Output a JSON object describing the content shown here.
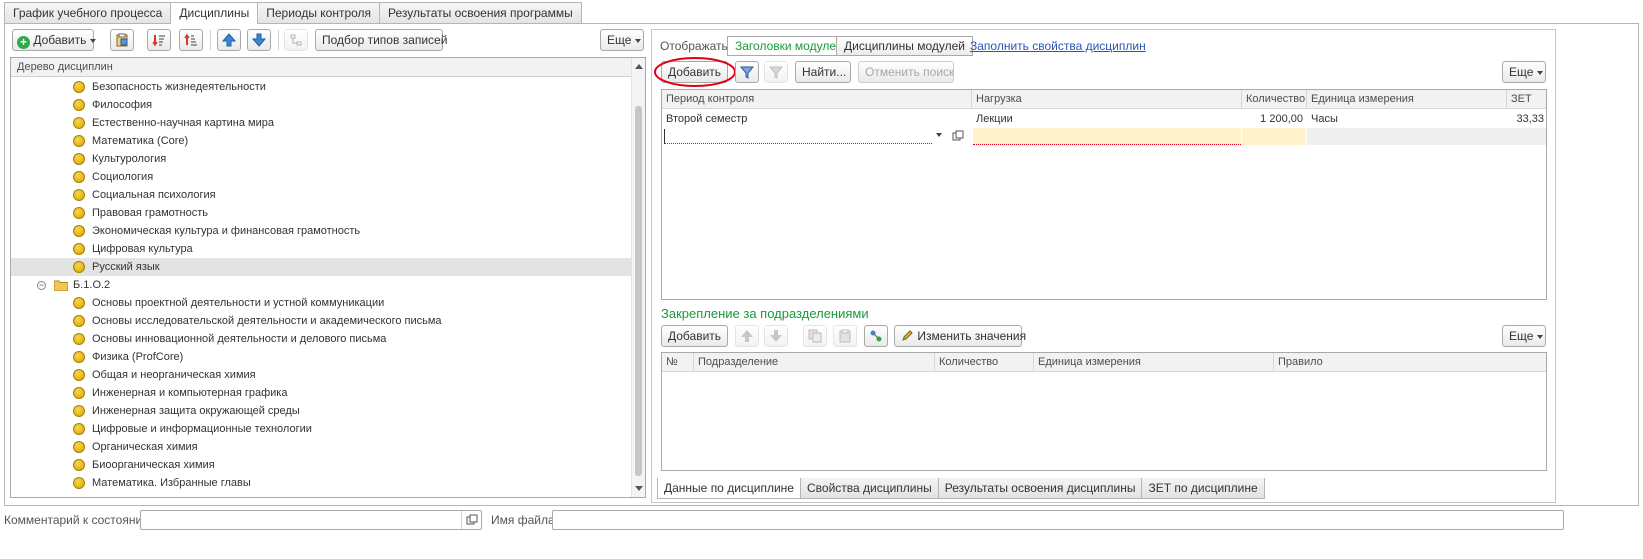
{
  "tabs": [
    {
      "label": "График учебного процесса",
      "active": false
    },
    {
      "label": "Дисциплины",
      "active": true
    },
    {
      "label": "Периоды контроля",
      "active": false
    },
    {
      "label": "Результаты освоения программы",
      "active": false
    }
  ],
  "left_toolbar": {
    "add_label": "Добавить",
    "select_types_label": "Подбор типов записей",
    "more_label": "Еще"
  },
  "tree": {
    "header": "Дерево дисциплин",
    "items": [
      {
        "label": "Безопасность жизнедеятельности"
      },
      {
        "label": "Философия"
      },
      {
        "label": "Естественно-научная картина мира"
      },
      {
        "label": "Математика (Core)"
      },
      {
        "label": "Культурология"
      },
      {
        "label": "Социология"
      },
      {
        "label": "Социальная психология"
      },
      {
        "label": "Правовая грамотность"
      },
      {
        "label": "Экономическая культура и финансовая грамотность"
      },
      {
        "label": "Цифровая культура"
      },
      {
        "label": "Русский язык"
      },
      {
        "label": "Б.1.О.2"
      },
      {
        "label": "Основы проектной деятельности и устной коммуникации"
      },
      {
        "label": "Основы исследовательской деятельности и академического письма"
      },
      {
        "label": "Основы инновационной деятельности и делового письма"
      },
      {
        "label": "Физика (ProfCore)"
      },
      {
        "label": "Общая и неорганическая химия"
      },
      {
        "label": "Инженерная и компьютерная графика"
      },
      {
        "label": "Инженерная защита окружающей среды"
      },
      {
        "label": "Цифровые и информационные технологии"
      },
      {
        "label": "Органическая химия"
      },
      {
        "label": "Биоорганическая химия"
      },
      {
        "label": "Математика. Избранные главы"
      }
    ]
  },
  "right": {
    "display_label": "Отображать:",
    "display_options": [
      "Заголовки модулей",
      "Дисциплины модулей"
    ],
    "fill_link": "Заполнить свойства дисциплин",
    "add_label": "Добавить",
    "find_label": "Найти...",
    "cancel_search_label": "Отменить поиск",
    "more_label": "Еще",
    "grid": {
      "columns": [
        "Период контроля",
        "Нагрузка",
        "Количество",
        "Единица измерения",
        "ЗЕТ"
      ],
      "rows": [
        [
          "Второй семестр",
          "Лекции",
          "1 200,00",
          "Часы",
          "33,33"
        ]
      ]
    },
    "section2_title": "Закрепление за подразделениями",
    "add2_label": "Добавить",
    "change_values_label": "Изменить значения",
    "more2_label": "Еще",
    "grid2": {
      "columns": [
        "№",
        "Подразделение",
        "Количество",
        "Единица измерения",
        "Правило"
      ]
    }
  },
  "bottom_tabs": [
    {
      "label": "Данные по дисциплине",
      "active": true
    },
    {
      "label": "Свойства дисциплины",
      "active": false
    },
    {
      "label": "Результаты освоения дисциплины",
      "active": false
    },
    {
      "label": "ЗЕТ по дисциплине",
      "active": false
    }
  ],
  "footer": {
    "comment_label": "Комментарий к состоянию:",
    "comment_value": "",
    "file_label": "Имя файла:",
    "file_value": ""
  },
  "colors": {
    "accent_green": "#1a9a3c",
    "link_blue": "#2a55b8",
    "highlight_red": "#e0001a",
    "edit_row_yellow": "#fff2cc"
  }
}
